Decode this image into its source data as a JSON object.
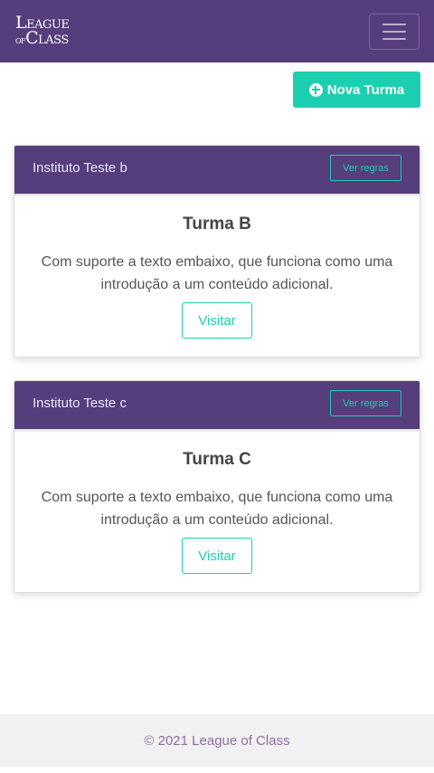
{
  "navbar": {
    "logo": {
      "line1": "League",
      "prefix": "of",
      "line2": "Class"
    }
  },
  "actions": {
    "new_class_label": "Nova Turma"
  },
  "cards": [
    {
      "institute": "Instituto Teste b",
      "rules_label": "Ver regras",
      "title": "Turma B",
      "text": "Com suporte a texto embaixo, que funciona como uma introdução a um conteúdo adicional.",
      "visit_label": "Visitar"
    },
    {
      "institute": "Instituto Teste c",
      "rules_label": "Ver regras",
      "title": "Turma C",
      "text": "Com suporte a texto embaixo, que funciona como uma introdução a um conteúdo adicional.",
      "visit_label": "Visitar"
    }
  ],
  "footer": {
    "text": "© 2021 League of Class"
  },
  "colors": {
    "primary": "#563d7c",
    "accent": "#1ccfb0"
  }
}
